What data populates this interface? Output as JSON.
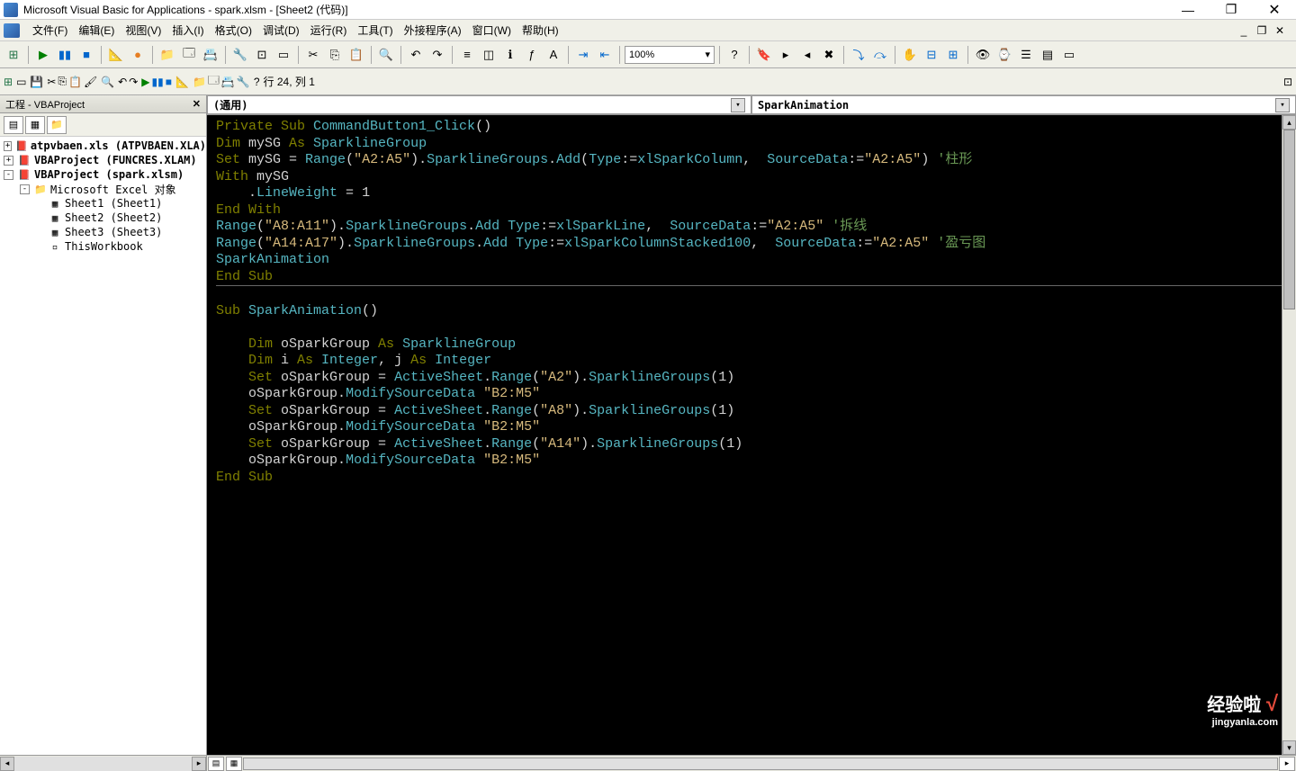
{
  "title": "Microsoft Visual Basic for Applications - spark.xlsm - [Sheet2 (代码)]",
  "menus": {
    "file": "文件(F)",
    "edit": "编辑(E)",
    "view": "视图(V)",
    "insert": "插入(I)",
    "format": "格式(O)",
    "debug": "调试(D)",
    "run": "运行(R)",
    "tools": "工具(T)",
    "addins": "外接程序(A)",
    "window": "窗口(W)",
    "help": "帮助(H)"
  },
  "zoom": "100%",
  "status_pos": "行 24, 列 1",
  "project_panel": {
    "title": "工程 - VBAProject",
    "items": [
      {
        "level": 1,
        "exp": "+",
        "icon": "📕",
        "label": "atpvbaen.xls (ATPVBAEN.XLA)",
        "bold": true
      },
      {
        "level": 1,
        "exp": "+",
        "icon": "📕",
        "label": "VBAProject (FUNCRES.XLAM)",
        "bold": true
      },
      {
        "level": 1,
        "exp": "-",
        "icon": "📕",
        "label": "VBAProject (spark.xlsm)",
        "bold": true
      },
      {
        "level": 2,
        "exp": "-",
        "icon": "📁",
        "label": "Microsoft Excel 对象",
        "bold": false
      },
      {
        "level": 3,
        "exp": "",
        "icon": "▦",
        "label": "Sheet1 (Sheet1)",
        "bold": false
      },
      {
        "level": 3,
        "exp": "",
        "icon": "▦",
        "label": "Sheet2 (Sheet2)",
        "bold": false
      },
      {
        "level": 3,
        "exp": "",
        "icon": "▦",
        "label": "Sheet3 (Sheet3)",
        "bold": false
      },
      {
        "level": 3,
        "exp": "",
        "icon": "▫",
        "label": "ThisWorkbook",
        "bold": false
      }
    ]
  },
  "code_dropdowns": {
    "left": "(通用)",
    "right": "SparkAnimation"
  },
  "code": [
    [
      {
        "t": "Private Sub ",
        "c": "kwdim"
      },
      {
        "t": "CommandButton1_Click",
        "c": "cyan"
      },
      {
        "t": "()",
        "c": "white"
      }
    ],
    [
      {
        "t": "Dim ",
        "c": "kwdim"
      },
      {
        "t": "mySG ",
        "c": "white"
      },
      {
        "t": "As ",
        "c": "kwdim"
      },
      {
        "t": "SparklineGroup",
        "c": "cyan"
      }
    ],
    [
      {
        "t": "Set ",
        "c": "kwdim"
      },
      {
        "t": "mySG ",
        "c": "white"
      },
      {
        "t": "= ",
        "c": "white"
      },
      {
        "t": "Range",
        "c": "cyan"
      },
      {
        "t": "(",
        "c": "white"
      },
      {
        "t": "\"A2:A5\"",
        "c": "yellow"
      },
      {
        "t": ").",
        "c": "white"
      },
      {
        "t": "SparklineGroups",
        "c": "cyan"
      },
      {
        "t": ".",
        "c": "white"
      },
      {
        "t": "Add",
        "c": "cyan"
      },
      {
        "t": "(",
        "c": "white"
      },
      {
        "t": "Type",
        "c": "cyan"
      },
      {
        "t": ":=",
        "c": "white"
      },
      {
        "t": "xlSparkColumn",
        "c": "cyan"
      },
      {
        "t": ",  ",
        "c": "white"
      },
      {
        "t": "SourceData",
        "c": "cyan"
      },
      {
        "t": ":=",
        "c": "white"
      },
      {
        "t": "\"A2:A5\"",
        "c": "yellow"
      },
      {
        "t": ") ",
        "c": "white"
      },
      {
        "t": "'柱形",
        "c": "comment"
      }
    ],
    [
      {
        "t": "With ",
        "c": "kwdim"
      },
      {
        "t": "mySG",
        "c": "white"
      }
    ],
    [
      {
        "t": "    .",
        "c": "white"
      },
      {
        "t": "LineWeight ",
        "c": "cyan"
      },
      {
        "t": "= ",
        "c": "white"
      },
      {
        "t": "1",
        "c": "white"
      }
    ],
    [
      {
        "t": "End With",
        "c": "kwdim"
      }
    ],
    [
      {
        "t": "Range",
        "c": "cyan"
      },
      {
        "t": "(",
        "c": "white"
      },
      {
        "t": "\"A8:A11\"",
        "c": "yellow"
      },
      {
        "t": ").",
        "c": "white"
      },
      {
        "t": "SparklineGroups",
        "c": "cyan"
      },
      {
        "t": ".",
        "c": "white"
      },
      {
        "t": "Add ",
        "c": "cyan"
      },
      {
        "t": "Type",
        "c": "cyan"
      },
      {
        "t": ":=",
        "c": "white"
      },
      {
        "t": "xlSparkLine",
        "c": "cyan"
      },
      {
        "t": ",  ",
        "c": "white"
      },
      {
        "t": "SourceData",
        "c": "cyan"
      },
      {
        "t": ":=",
        "c": "white"
      },
      {
        "t": "\"A2:A5\"",
        "c": "yellow"
      },
      {
        "t": " '拆线",
        "c": "comment"
      }
    ],
    [
      {
        "t": "Range",
        "c": "cyan"
      },
      {
        "t": "(",
        "c": "white"
      },
      {
        "t": "\"A14:A17\"",
        "c": "yellow"
      },
      {
        "t": ").",
        "c": "white"
      },
      {
        "t": "SparklineGroups",
        "c": "cyan"
      },
      {
        "t": ".",
        "c": "white"
      },
      {
        "t": "Add ",
        "c": "cyan"
      },
      {
        "t": "Type",
        "c": "cyan"
      },
      {
        "t": ":=",
        "c": "white"
      },
      {
        "t": "xlSparkColumnStacked100",
        "c": "cyan"
      },
      {
        "t": ",  ",
        "c": "white"
      },
      {
        "t": "SourceData",
        "c": "cyan"
      },
      {
        "t": ":=",
        "c": "white"
      },
      {
        "t": "\"A2:A5\"",
        "c": "yellow"
      },
      {
        "t": " '盈亏图",
        "c": "comment"
      }
    ],
    [
      {
        "t": "SparkAnimation",
        "c": "cyan"
      }
    ],
    [
      {
        "t": "End Sub",
        "c": "kwdim"
      }
    ],
    "HR",
    [],
    [
      {
        "t": "Sub ",
        "c": "kwdim"
      },
      {
        "t": "SparkAnimation",
        "c": "cyan"
      },
      {
        "t": "()",
        "c": "white"
      }
    ],
    [],
    [
      {
        "t": "    Dim ",
        "c": "kwdim"
      },
      {
        "t": "oSparkGroup ",
        "c": "white"
      },
      {
        "t": "As ",
        "c": "kwdim"
      },
      {
        "t": "SparklineGroup",
        "c": "cyan"
      }
    ],
    [
      {
        "t": "    Dim ",
        "c": "kwdim"
      },
      {
        "t": "i ",
        "c": "white"
      },
      {
        "t": "As ",
        "c": "kwdim"
      },
      {
        "t": "Integer",
        "c": "cyan"
      },
      {
        "t": ", ",
        "c": "white"
      },
      {
        "t": "j ",
        "c": "white"
      },
      {
        "t": "As ",
        "c": "kwdim"
      },
      {
        "t": "Integer",
        "c": "cyan"
      }
    ],
    [
      {
        "t": "    Set ",
        "c": "kwdim"
      },
      {
        "t": "oSparkGroup ",
        "c": "white"
      },
      {
        "t": "= ",
        "c": "white"
      },
      {
        "t": "ActiveSheet",
        "c": "cyan"
      },
      {
        "t": ".",
        "c": "white"
      },
      {
        "t": "Range",
        "c": "cyan"
      },
      {
        "t": "(",
        "c": "white"
      },
      {
        "t": "\"A2\"",
        "c": "yellow"
      },
      {
        "t": ").",
        "c": "white"
      },
      {
        "t": "SparklineGroups",
        "c": "cyan"
      },
      {
        "t": "(",
        "c": "white"
      },
      {
        "t": "1",
        "c": "white"
      },
      {
        "t": ")",
        "c": "white"
      }
    ],
    [
      {
        "t": "    ",
        "c": "white"
      },
      {
        "t": "oSparkGroup",
        "c": "white"
      },
      {
        "t": ".",
        "c": "white"
      },
      {
        "t": "ModifySourceData ",
        "c": "cyan"
      },
      {
        "t": "\"B2:M5\"",
        "c": "yellow"
      }
    ],
    [
      {
        "t": "    Set ",
        "c": "kwdim"
      },
      {
        "t": "oSparkGroup ",
        "c": "white"
      },
      {
        "t": "= ",
        "c": "white"
      },
      {
        "t": "ActiveSheet",
        "c": "cyan"
      },
      {
        "t": ".",
        "c": "white"
      },
      {
        "t": "Range",
        "c": "cyan"
      },
      {
        "t": "(",
        "c": "white"
      },
      {
        "t": "\"A8\"",
        "c": "yellow"
      },
      {
        "t": ").",
        "c": "white"
      },
      {
        "t": "SparklineGroups",
        "c": "cyan"
      },
      {
        "t": "(",
        "c": "white"
      },
      {
        "t": "1",
        "c": "white"
      },
      {
        "t": ")",
        "c": "white"
      }
    ],
    [
      {
        "t": "    ",
        "c": "white"
      },
      {
        "t": "oSparkGroup",
        "c": "white"
      },
      {
        "t": ".",
        "c": "white"
      },
      {
        "t": "ModifySourceData ",
        "c": "cyan"
      },
      {
        "t": "\"B2:M5\"",
        "c": "yellow"
      }
    ],
    [
      {
        "t": "    Set ",
        "c": "kwdim"
      },
      {
        "t": "oSparkGroup ",
        "c": "white"
      },
      {
        "t": "= ",
        "c": "white"
      },
      {
        "t": "ActiveSheet",
        "c": "cyan"
      },
      {
        "t": ".",
        "c": "white"
      },
      {
        "t": "Range",
        "c": "cyan"
      },
      {
        "t": "(",
        "c": "white"
      },
      {
        "t": "\"A14\"",
        "c": "yellow"
      },
      {
        "t": ").",
        "c": "white"
      },
      {
        "t": "SparklineGroups",
        "c": "cyan"
      },
      {
        "t": "(",
        "c": "white"
      },
      {
        "t": "1",
        "c": "white"
      },
      {
        "t": ")",
        "c": "white"
      }
    ],
    [
      {
        "t": "    ",
        "c": "white"
      },
      {
        "t": "oSparkGroup",
        "c": "white"
      },
      {
        "t": ".",
        "c": "white"
      },
      {
        "t": "ModifySourceData ",
        "c": "cyan"
      },
      {
        "t": "\"B2:M5\"",
        "c": "yellow"
      }
    ],
    [
      {
        "t": "End Sub",
        "c": "kwdim"
      }
    ]
  ],
  "watermark": {
    "main": "经验啦",
    "check": "√",
    "sub": "jingyanla.com"
  }
}
